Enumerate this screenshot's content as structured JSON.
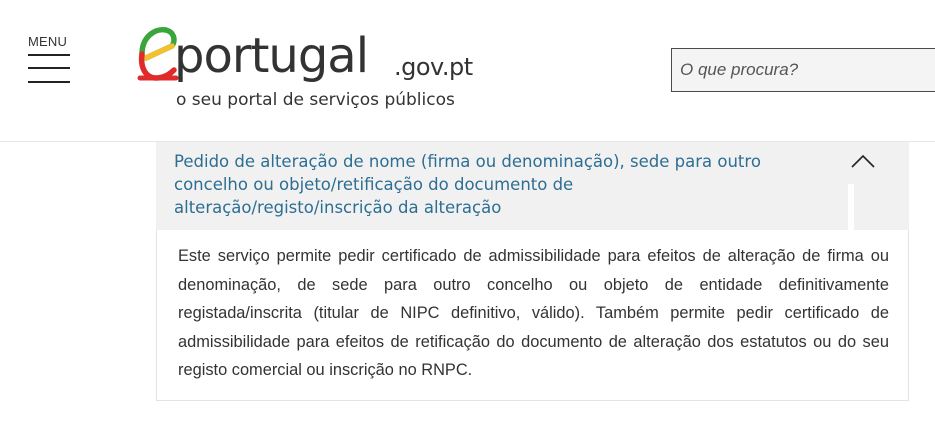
{
  "header": {
    "menu_label": "MENU",
    "logo": {
      "word": "portugal",
      "domain": ".gov.pt",
      "tagline": "o seu portal de serviços públicos"
    },
    "search": {
      "placeholder": "O que procura?"
    }
  },
  "accordion": {
    "title_lines": [
      "Pedido de alteração de nome (firma ou denominação), sede para outro",
      "concelho ou objeto/retificação do documento de",
      "alteração/registo/inscrição da alteração"
    ],
    "expanded": true,
    "toggle_icon": "chevron-up-icon",
    "body_lines": [
      "Este serviço permite pedir certificado de admissibilidade para efeitos de alteração de firma ou",
      "denominação, de sede para outro concelho ou objeto de entidade definitivamente",
      "registada/inscrita (titular de NIPC definitivo, válido). Também permite pedir certificado de",
      "admissibilidade para efeitos de retificação do documento de alteração dos estatutos ou do seu",
      "registo comercial ou inscrição no RNPC."
    ]
  },
  "colors": {
    "title_blue": "#2d6e93",
    "logo_green": "#3aa53a",
    "logo_yellow": "#f2c12e",
    "logo_red": "#e02b2b",
    "header_bg": "#f1f1f1"
  }
}
